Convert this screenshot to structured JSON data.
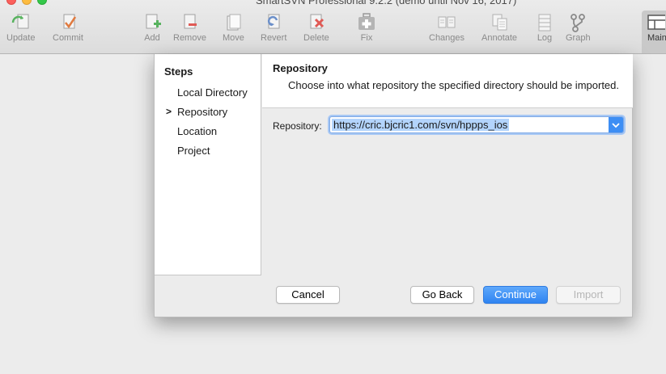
{
  "window": {
    "title": "SmartSVN Professional 9.2.2 (demo until Nov 16, 2017)"
  },
  "toolbar": {
    "update": "Update",
    "commit": "Commit",
    "add": "Add",
    "remove": "Remove",
    "move": "Move",
    "revert": "Revert",
    "delete": "Delete",
    "fix": "Fix",
    "changes": "Changes",
    "annotate": "Annotate",
    "log": "Log",
    "graph": "Graph",
    "main": "Main"
  },
  "steps": {
    "title": "Steps",
    "marker": ">",
    "items": [
      "Local Directory",
      "Repository",
      "Location",
      "Project"
    ]
  },
  "page": {
    "title": "Repository",
    "description": "Choose into what repository the specified directory should be imported."
  },
  "repository": {
    "label": "Repository:",
    "value": "https://cric.bjcric1.com/svn/hppps_ios"
  },
  "buttons": {
    "cancel": "Cancel",
    "go_back": "Go Back",
    "continue": "Continue",
    "import": "Import"
  },
  "colors": {
    "primary": "#2f84f1",
    "selection": "#b3d4fc",
    "icon_green": "#58b35f",
    "icon_red": "#e05a55"
  }
}
